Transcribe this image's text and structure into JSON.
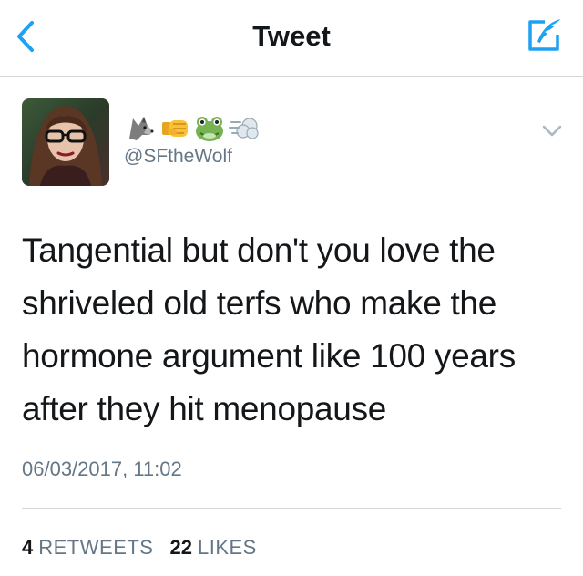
{
  "nav": {
    "title": "Tweet",
    "back_icon": "chevron-left-icon",
    "compose_icon": "compose-feather-icon",
    "accent": "#1da1f2"
  },
  "tweet": {
    "display_name_emojis": [
      "wolf",
      "right-facing-fist",
      "frog",
      "dash-symbol"
    ],
    "handle": "@SFtheWolf",
    "text": "Tangential but don't you love the shriveled old terfs who make the hormone argument like 100 years after they hit menopause",
    "timestamp": "06/03/2017, 11:02",
    "retweets_count": "4",
    "retweets_label": "RETWEETS",
    "likes_count": "22",
    "likes_label": "LIKES"
  },
  "colors": {
    "text": "#14171a",
    "secondary": "#657786",
    "divider": "#d6d6d6"
  }
}
